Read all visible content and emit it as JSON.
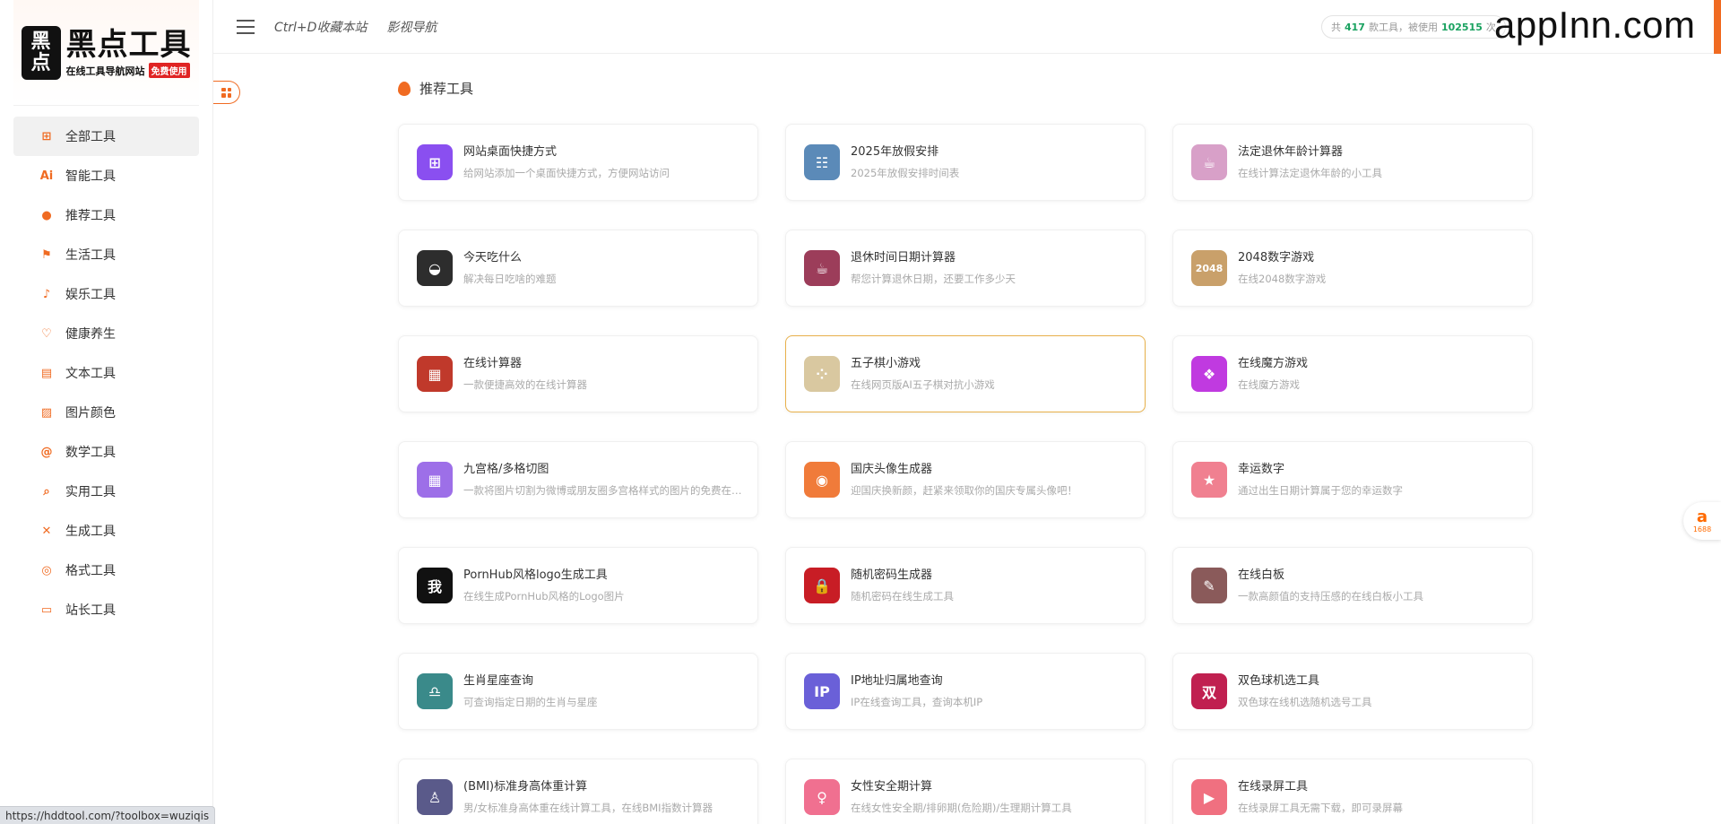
{
  "logo": {
    "box_line1": "黑",
    "box_line2": "点",
    "main": "黑点工具",
    "sub": "在线工具导航网站",
    "badge": "免费使用"
  },
  "sidebar": {
    "items": [
      {
        "label": "全部工具",
        "icon": "grid-plus-icon",
        "glyph": "⊞",
        "active": true
      },
      {
        "label": "智能工具",
        "icon": "ai-icon",
        "glyph": "Ai",
        "active": false
      },
      {
        "label": "推荐工具",
        "icon": "flame-icon",
        "glyph": "●",
        "active": false
      },
      {
        "label": "生活工具",
        "icon": "flag-icon",
        "glyph": "⚑",
        "active": false
      },
      {
        "label": "娱乐工具",
        "icon": "music-note-icon",
        "glyph": "♪",
        "active": false
      },
      {
        "label": "健康养生",
        "icon": "heart-icon",
        "glyph": "♡",
        "active": false
      },
      {
        "label": "文本工具",
        "icon": "document-icon",
        "glyph": "▤",
        "active": false
      },
      {
        "label": "图片颜色",
        "icon": "image-icon",
        "glyph": "▨",
        "active": false
      },
      {
        "label": "数学工具",
        "icon": "at-icon",
        "glyph": "@",
        "active": false
      },
      {
        "label": "实用工具",
        "icon": "search-icon",
        "glyph": "⌕",
        "active": false
      },
      {
        "label": "生成工具",
        "icon": "tools-icon",
        "glyph": "✕",
        "active": false
      },
      {
        "label": "格式工具",
        "icon": "code-icon",
        "glyph": "◎",
        "active": false
      },
      {
        "label": "站长工具",
        "icon": "monitor-icon",
        "glyph": "▭",
        "active": false
      }
    ]
  },
  "header": {
    "bookmark_hint": "Ctrl+D收藏本站",
    "nav_link": "影视导航",
    "stats": {
      "prefix": "共",
      "tool_count": "417",
      "mid": "款工具，被使用",
      "use_count": "102515",
      "suffix": "次"
    }
  },
  "watermark": "appInn.com",
  "section": {
    "title": "推荐工具"
  },
  "cards": [
    {
      "title": "网站桌面快捷方式",
      "desc": "给网站添加一个桌面快捷方式，方便网站访问",
      "icon": "shortcut-grid-icon",
      "glyph": "⊞",
      "color": "#8a4ff0",
      "highlight": false
    },
    {
      "title": "2025年放假安排",
      "desc": "2025年放假安排时间表",
      "icon": "calendar-icon",
      "glyph": "☷",
      "color": "#5b8ab8",
      "highlight": false
    },
    {
      "title": "法定退休年龄计算器",
      "desc": "在线计算法定退休年龄的小工具",
      "icon": "coffee-cup-icon",
      "glyph": "☕",
      "color": "#d8a0c8",
      "highlight": false
    },
    {
      "title": "今天吃什么",
      "desc": "解决每日吃啥的难题",
      "icon": "bowl-icon",
      "glyph": "◒",
      "color": "#2d2d2d",
      "highlight": false
    },
    {
      "title": "退休时间日期计算器",
      "desc": "帮您计算退休日期，还要工作多少天",
      "icon": "cup-icon",
      "glyph": "☕",
      "color": "#9c3d5a",
      "highlight": false
    },
    {
      "title": "2048数字游戏",
      "desc": "在线2048数字游戏",
      "icon": "game-2048-icon",
      "glyph": "2048",
      "color": "#c9a06a",
      "highlight": false
    },
    {
      "title": "在线计算器",
      "desc": "一款便捷高效的在线计算器",
      "icon": "calculator-icon",
      "glyph": "▦",
      "color": "#c0392b",
      "highlight": false
    },
    {
      "title": "五子棋小游戏",
      "desc": "在线网页版AI五子棋对抗小游戏",
      "icon": "gomoku-icon",
      "glyph": "⁘",
      "color": "#d9c8a0",
      "highlight": true
    },
    {
      "title": "在线魔方游戏",
      "desc": "在线魔方游戏",
      "icon": "cube-icon",
      "glyph": "❖",
      "color": "#c03ae0",
      "highlight": false
    },
    {
      "title": "九宫格/多格切图",
      "desc": "一款将图片切割为微博或朋友圈多宫格样式的图片的免费在线工具",
      "icon": "nine-grid-icon",
      "glyph": "▦",
      "color": "#9d6fe8",
      "highlight": false
    },
    {
      "title": "国庆头像生成器",
      "desc": "迎国庆换新颜，赶紧来领取你的国庆专属头像吧！",
      "icon": "avatar-icon",
      "glyph": "◉",
      "color": "#f07b3a",
      "highlight": false
    },
    {
      "title": "幸运数字",
      "desc": "通过出生日期计算属于您的幸运数字",
      "icon": "star-icon",
      "glyph": "★",
      "color": "#f08090",
      "highlight": false
    },
    {
      "title": "PornHub风格logo生成工具",
      "desc": "在线生成PornHub风格的Logo图片",
      "icon": "logo-generator-icon",
      "glyph": "我",
      "color": "#111111",
      "highlight": false
    },
    {
      "title": "随机密码生成器",
      "desc": "随机密码在线生成工具",
      "icon": "lock-icon",
      "glyph": "🔒",
      "color": "#c81d25",
      "highlight": false
    },
    {
      "title": "在线白板",
      "desc": "一款高颜值的支持压感的在线白板小工具",
      "icon": "whiteboard-icon",
      "glyph": "✎",
      "color": "#8a5a5a",
      "highlight": false
    },
    {
      "title": "生肖星座查询",
      "desc": "可查询指定日期的生肖与星座",
      "icon": "zodiac-icon",
      "glyph": "♎",
      "color": "#3a8a8a",
      "highlight": false
    },
    {
      "title": "IP地址归属地查询",
      "desc": "IP在线查询工具，查询本机IP",
      "icon": "ip-icon",
      "glyph": "IP",
      "color": "#6a60d8",
      "highlight": false
    },
    {
      "title": "双色球机选工具",
      "desc": "双色球在线机选随机选号工具",
      "icon": "lottery-ball-icon",
      "glyph": "双",
      "color": "#c02050",
      "highlight": false
    },
    {
      "title": "(BMI)标准身高体重计算",
      "desc": "男/女标准身高体重在线计算工具，在线BMI指数计算器",
      "icon": "bmi-icon",
      "glyph": "♙",
      "color": "#5a5a8a",
      "highlight": false
    },
    {
      "title": "女性安全期计算",
      "desc": "在线女性安全期/排卵期(危险期)/生理期计算工具",
      "icon": "female-icon",
      "glyph": "♀",
      "color": "#f07090",
      "highlight": false
    },
    {
      "title": "在线录屏工具",
      "desc": "在线录屏工具无需下载，即可录屏幕",
      "icon": "screen-record-icon",
      "glyph": "▶",
      "color": "#f07080",
      "highlight": false
    }
  ],
  "statusbar": {
    "url": "https://hddtool.com/?toolbox=wuziqis"
  },
  "ali_badge": {
    "glyph": "a",
    "label": "1688"
  }
}
